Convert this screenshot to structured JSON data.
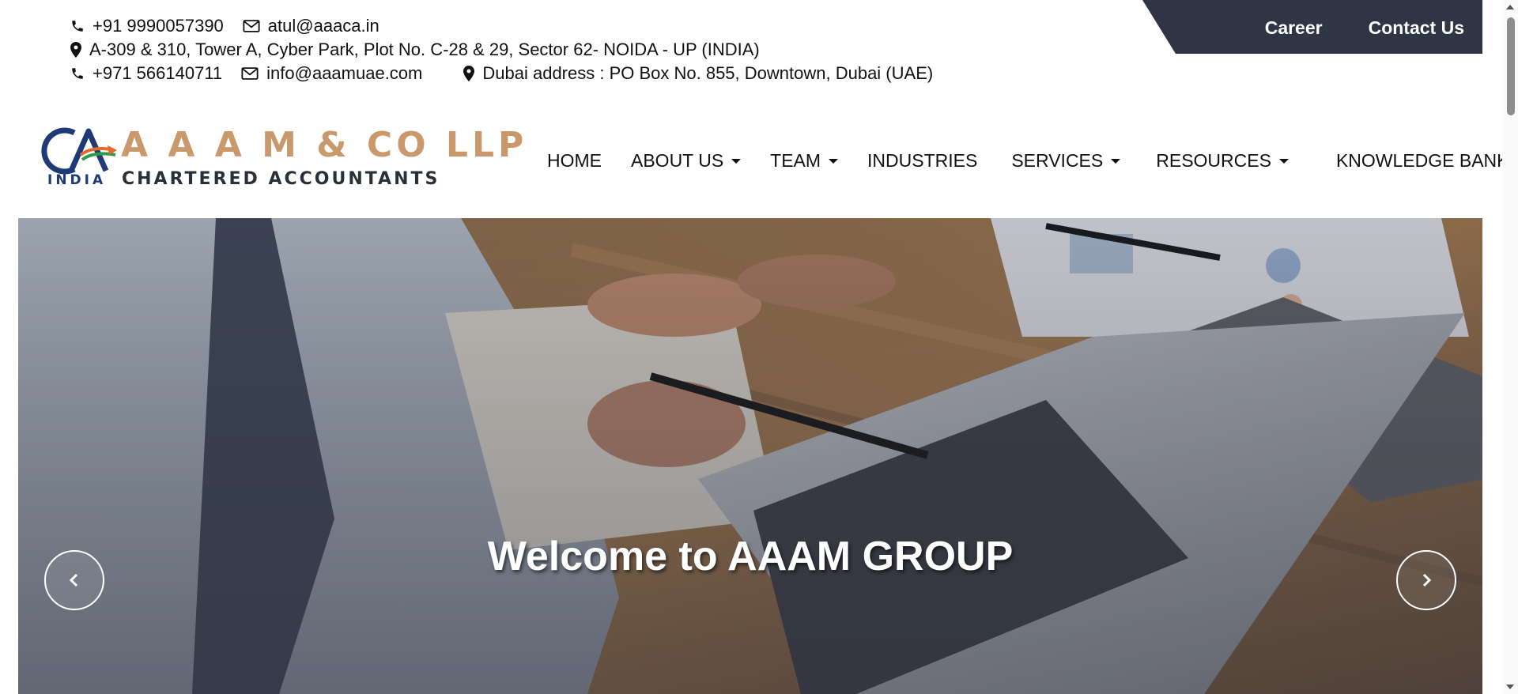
{
  "contact": {
    "phone_india": "+91 9990057390",
    "email_india": "atul@aaaca.in",
    "address_india": "A-309 & 310, Tower A, Cyber Park, Plot No. C-28 & 29, Sector 62- NOIDA - UP (INDIA)",
    "phone_uae": "+971 566140711",
    "email_uae": "info@aaamuae.com",
    "address_uae": "Dubai address : PO Box No. 855, Downtown, Dubai (UAE)"
  },
  "top_links": {
    "career": "Career",
    "contact_us": "Contact Us",
    "bg_color": "#2f3545"
  },
  "logo": {
    "mark_text": "CA",
    "region": "INDIA",
    "title": "A A A M & CO LLP",
    "subtitle": "CHARTERED ACCOUNTANTS",
    "title_color": "#c9996b",
    "mark_color": "#1f3b75"
  },
  "nav": {
    "items": [
      {
        "label": "HOME",
        "dropdown": false
      },
      {
        "label": "ABOUT US",
        "dropdown": true
      },
      {
        "label": "TEAM",
        "dropdown": true
      },
      {
        "label": "INDUSTRIES",
        "dropdown": false
      },
      {
        "label": "SERVICES",
        "dropdown": true
      },
      {
        "label": "RESOURCES",
        "dropdown": true
      },
      {
        "label": "KNOWLEDGE BANK",
        "dropdown": true
      }
    ]
  },
  "hero": {
    "title": "Welcome to AAAM GROUP",
    "prev_icon": "chevron-left-icon",
    "next_icon": "chevron-right-icon"
  }
}
